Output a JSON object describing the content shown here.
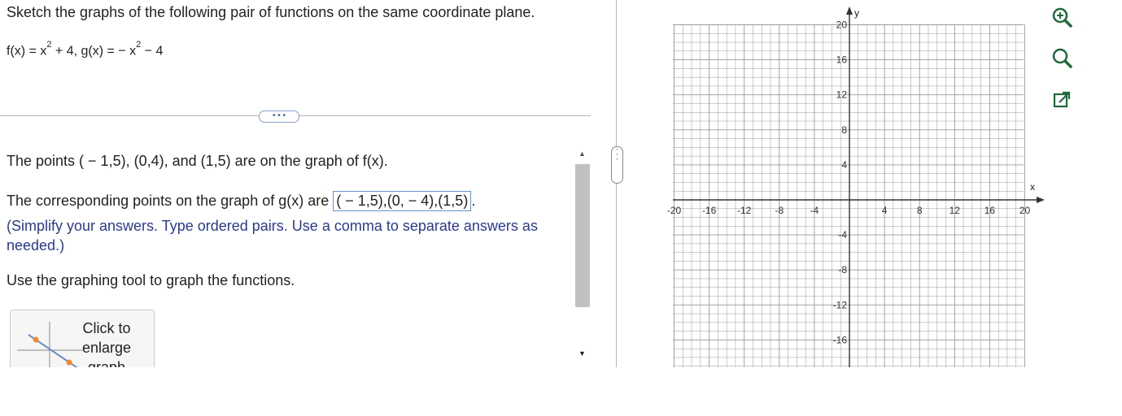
{
  "question": {
    "instruction": "Sketch the graphs of the following pair of functions on the same coordinate plane.",
    "f_prefix": "f(x) = x",
    "f_exp": "2",
    "f_suffix": " + 4, g(x) = − x",
    "g_exp": "2",
    "g_suffix": " − 4"
  },
  "more_button": "• • •",
  "solution": {
    "points_text": "The points ( − 1,5), (0,4), and (1,5) are on the graph of f(x).",
    "corresponding_prefix": "The corresponding points on the graph of g(x) are ",
    "answer": "( − 1,5),(0, − 4),(1,5)",
    "corresponding_suffix": ".",
    "hint": "(Simplify your answers. Type ordered pairs. Use a comma to separate answers as needed.)",
    "tool_text": "Use the graphing tool to graph the functions."
  },
  "enlarge_button": {
    "line1": "Click to",
    "line2": "enlarge",
    "line3": "graph"
  },
  "graph": {
    "x_label": "x",
    "y_label": "y",
    "x_range": [
      -20,
      20
    ],
    "y_range": [
      -20,
      20
    ],
    "x_ticks": [
      "-20",
      "-16",
      "-12",
      "-8",
      "-4",
      "4",
      "8",
      "12",
      "16",
      "20"
    ],
    "y_ticks": [
      "20",
      "16",
      "12",
      "8",
      "4",
      "-4",
      "-8",
      "-12",
      "-16"
    ]
  },
  "colors": {
    "hint": "#2b3a8a",
    "answer_border": "#6a8fce",
    "grid": "#9a9a9a",
    "tool_green": "#1e6b3a"
  },
  "icons": [
    "zoom-in-icon",
    "zoom-out-icon",
    "open-external-icon",
    "scroll-up-icon",
    "scroll-down-icon"
  ]
}
